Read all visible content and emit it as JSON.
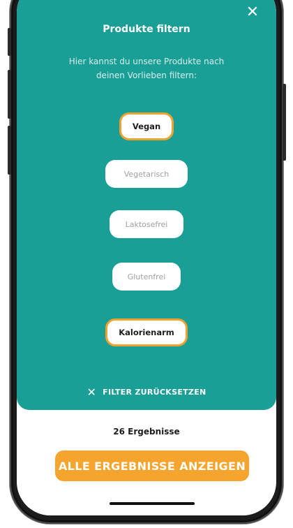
{
  "header": {
    "title": "Produkte filtern",
    "close_icon": "close-icon"
  },
  "intro_text": "Hier kannst du unsere Produkte nach deinen Vorlieben filtern:",
  "filters": [
    {
      "label": "Vegan",
      "selected": true
    },
    {
      "label": "Vegetarisch",
      "selected": false
    },
    {
      "label": "Laktosefrei",
      "selected": false
    },
    {
      "label": "Glutenfrei",
      "selected": false
    },
    {
      "label": "Kalorienarm",
      "selected": true
    }
  ],
  "reset": {
    "icon": "close-icon",
    "label": "FILTER ZURÜCKSETZEN"
  },
  "results": {
    "count_text": "26 Ergebnisse",
    "button_label": "ALLE ERGEBNISSE ANZEIGEN"
  },
  "colors": {
    "teal": "#1a9f96",
    "accent": "#f5a42e",
    "selected_border": "#f0a22e"
  }
}
